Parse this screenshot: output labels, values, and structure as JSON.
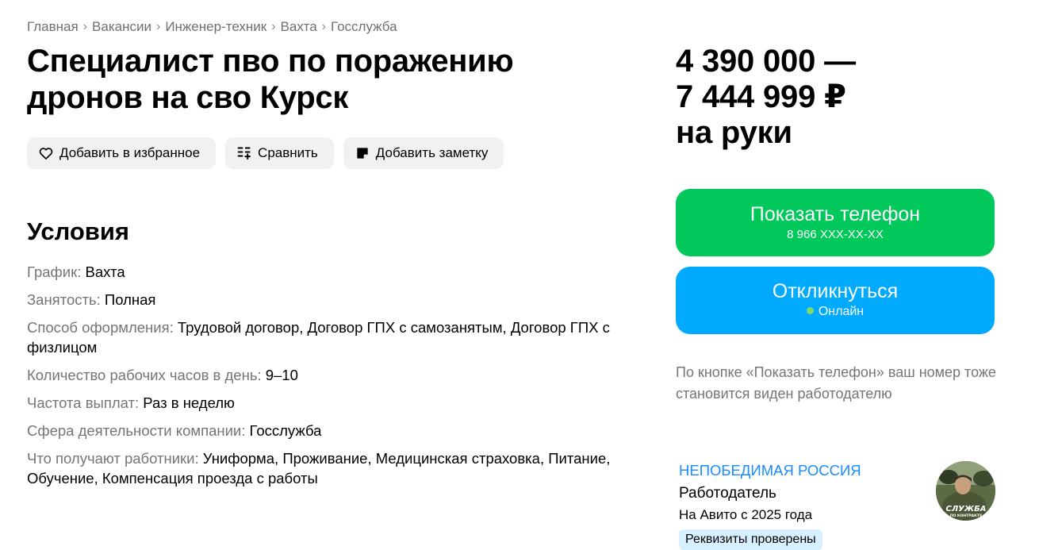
{
  "breadcrumbs": [
    "Главная",
    "Вакансии",
    "Инженер-техник",
    "Вахта",
    "Госслужба"
  ],
  "title": "Специалист пво по поражению дронов на сво Курск",
  "actions": {
    "favorite": "Добавить в избранное",
    "compare": "Сравнить",
    "note": "Добавить заметку"
  },
  "conditions": {
    "heading": "Условия",
    "rows": [
      {
        "label": "График:",
        "value": "Вахта"
      },
      {
        "label": "Занятость:",
        "value": "Полная"
      },
      {
        "label": "Способ оформления:",
        "value": "Трудовой договор, Договор ГПХ с самозанятым, Договор ГПХ с физлицом"
      },
      {
        "label": "Количество рабочих часов в день:",
        "value": "9–10"
      },
      {
        "label": "Частота выплат:",
        "value": "Раз в неделю"
      },
      {
        "label": "Сфера деятельности компании:",
        "value": "Госслужба"
      },
      {
        "label": "Что получают работники:",
        "value": "Униформа, Проживание, Медицинская страховка, Питание, Обучение, Компенсация проезда с работы"
      }
    ]
  },
  "price": {
    "line1": "4 390 000 —",
    "line2": "7 444 999 ₽",
    "line3": "на руки"
  },
  "phone_button": {
    "label": "Показать телефон",
    "number": "8 966 XXX-XX-XX"
  },
  "respond_button": {
    "label": "Откликнуться",
    "status": "Онлайн"
  },
  "hint": "По кнопке «Показать телефон» ваш номер тоже становится виден работодателю",
  "employer": {
    "name": "НЕПОБЕДИМАЯ РОССИЯ",
    "role": "Работодатель",
    "since": "На Авито с 2025 года",
    "badge": "Реквизиты проверены",
    "avatar_text_1": "СЛУЖБА",
    "avatar_text_2": "ПО КОНТРАКТУ"
  },
  "colors": {
    "phone_button": "#00c85a",
    "respond_button": "#00aaff",
    "employer_link": "#1a8cff",
    "badge": "#d6f0ff",
    "online_dot": "#80d96b"
  }
}
